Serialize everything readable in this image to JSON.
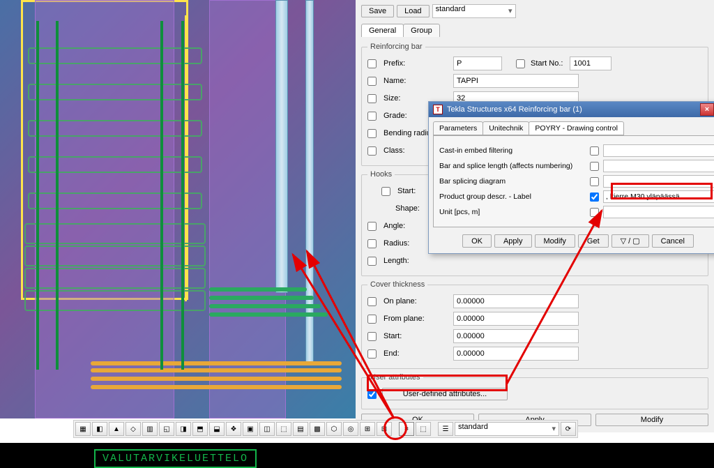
{
  "mainPanel": {
    "saveBtn": "Save",
    "loadBtn": "Load",
    "preset": "standard",
    "tabs": {
      "general": "General",
      "group": "Group"
    },
    "reinforcingBar": {
      "legend": "Reinforcing bar",
      "prefixLabel": "Prefix:",
      "prefixValue": "P",
      "startNoLabel": "Start No.:",
      "startNoValue": "1001",
      "nameLabel": "Name:",
      "nameValue": "TAPPI",
      "sizeLabel": "Size:",
      "sizeValue": "32",
      "gradeLabel": "Grade:",
      "bendingRadiusLabel": "Bending radius:",
      "classLabel": "Class:"
    },
    "hooks": {
      "legend": "Hooks",
      "startLabel": "Start:",
      "shapeLabel": "Shape:",
      "angleLabel": "Angle:",
      "radiusLabel": "Radius:",
      "lengthLabel": "Length:"
    },
    "cover": {
      "legend": "Cover thickness",
      "onPlaneLabel": "On plane:",
      "onPlaneValue": "0.00000",
      "fromPlaneLabel": "From plane:",
      "fromPlaneValue": "0.00000",
      "startLabel": "Start:",
      "startValue": "0.00000",
      "endLabel": "End:",
      "endValue": "0.00000"
    },
    "userAttr": {
      "legend": "User attributes",
      "udaBtn": "User-defined attributes..."
    },
    "okBtn": "OK",
    "applyBtn": "Apply",
    "modifyBtn": "Modify"
  },
  "popup": {
    "title": "Tekla Structures x64  Reinforcing bar (1)",
    "tabs": {
      "parameters": "Parameters",
      "unitechnik": "Unitechnik",
      "poyry": "POYRY - Drawing control"
    },
    "rows": {
      "castIn": "Cast-in embed filtering",
      "barSplice": "Bar and splice length (affects numbering)",
      "barSplicingDiag": "Bar splicing diagram",
      "productGroup": "Product group descr. - Label",
      "productGroupValue": ", kierre M30 yläpäässä",
      "unit": "Unit [pcs, m]"
    },
    "okBtn": "OK",
    "applyBtn": "Apply",
    "modifyBtn": "Modify",
    "getBtn": "Get",
    "toggleBtn": "▽ / ▢",
    "cancelBtn": "Cancel"
  },
  "toolbar": {
    "preset": "standard"
  },
  "footer": {
    "text": "VALUTARVIKELUETTELO"
  }
}
